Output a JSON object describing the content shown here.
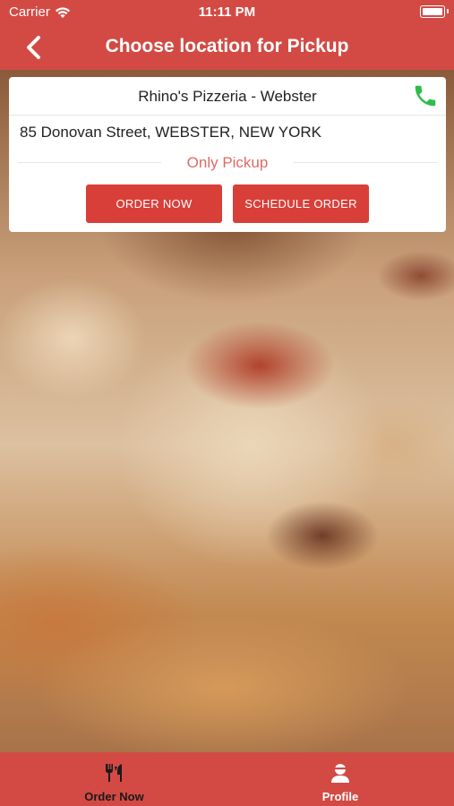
{
  "status_bar": {
    "carrier": "Carrier",
    "time": "11:11 PM"
  },
  "nav": {
    "title": "Choose location for Pickup",
    "back_icon": "chevron-left-icon"
  },
  "location": {
    "name": "Rhino's Pizzeria - Webster",
    "address": "85 Donovan Street, WEBSTER, NEW YORK",
    "pickup_label": "Only Pickup",
    "order_now_label": "ORDER NOW",
    "schedule_label": "SCHEDULE ORDER",
    "phone_icon": "phone-icon",
    "phone_color": "#2ebd4a"
  },
  "tab_bar": {
    "items": [
      {
        "label": "Order Now",
        "icon": "fork-knife-icon",
        "active": true
      },
      {
        "label": "Profile",
        "icon": "user-icon",
        "active": false
      }
    ]
  },
  "colors": {
    "primary": "#d34a44",
    "button": "#d93f39",
    "pickup_text": "#e06a63"
  }
}
